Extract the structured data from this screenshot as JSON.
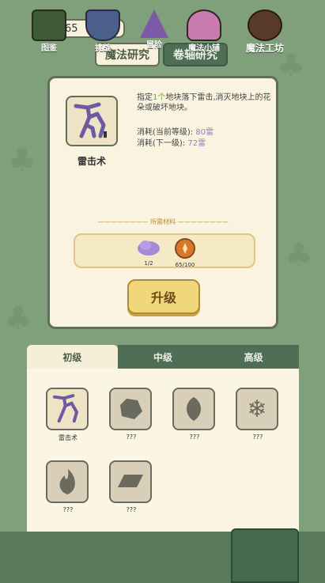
{
  "currency": {
    "amount": "65",
    "icon": "coin-icon",
    "color": "#e08b3a"
  },
  "top_tabs": [
    {
      "label": "魔法研究",
      "active": true
    },
    {
      "label": "卷轴研究",
      "active": false
    }
  ],
  "spell": {
    "name": "雷击术",
    "description_prefix": "指定",
    "description_count": "1个",
    "description_suffix": "地块落下雷击,消灭地块上的花朵或破坏地块。",
    "cost_current_label": "消耗(当前等级):",
    "cost_current_value": "80雷",
    "cost_next_label": "消耗(下一级):",
    "cost_next_value": "72雷"
  },
  "materials": {
    "title": "所需材料",
    "items": [
      {
        "icon": "purple-cloud-icon",
        "count": "1/2"
      },
      {
        "icon": "gold-coin-icon",
        "count": "65/100"
      }
    ]
  },
  "upgrade_label": "升级",
  "tiers": [
    {
      "label": "初级",
      "active": true
    },
    {
      "label": "中级",
      "active": false
    },
    {
      "label": "高级",
      "active": false
    }
  ],
  "spells_grid": [
    {
      "label": "雷击术",
      "icon": "lightning-tree-icon",
      "unlocked": true
    },
    {
      "label": "???",
      "icon": "rock-icon",
      "unlocked": false
    },
    {
      "label": "???",
      "icon": "leaf-icon",
      "unlocked": false
    },
    {
      "label": "???",
      "icon": "snowflake-icon",
      "unlocked": false
    },
    {
      "label": "???",
      "icon": "flame-icon",
      "unlocked": false
    },
    {
      "label": "???",
      "icon": "ingot-icon",
      "unlocked": false
    }
  ],
  "nav": [
    {
      "label": "图鉴",
      "icon": "book-icon"
    },
    {
      "label": "挑战",
      "icon": "shield-icon"
    },
    {
      "label": "冒险",
      "icon": "wizard-hat-icon"
    },
    {
      "label": "魔法小铺",
      "icon": "potion-shop-icon"
    },
    {
      "label": "魔法工坊",
      "icon": "cauldron-icon",
      "active": true
    }
  ]
}
